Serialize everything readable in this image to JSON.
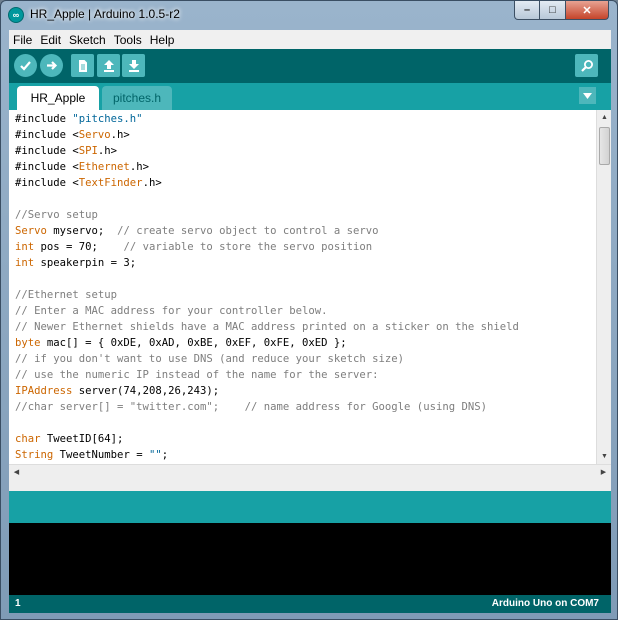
{
  "window": {
    "title": "HR_Apple | Arduino 1.0.5-r2",
    "icon": "arduino-logo-icon",
    "controls": {
      "minimize": "–",
      "maximize": "□",
      "close": "✕"
    }
  },
  "menu": {
    "items": [
      "File",
      "Edit",
      "Sketch",
      "Tools",
      "Help"
    ]
  },
  "toolbar": {
    "buttons": [
      {
        "name": "verify",
        "icon": "checkmark-icon"
      },
      {
        "name": "upload",
        "icon": "arrow-right-icon"
      },
      {
        "name": "new",
        "icon": "new-file-icon"
      },
      {
        "name": "open",
        "icon": "arrow-up-icon"
      },
      {
        "name": "save",
        "icon": "arrow-down-icon"
      },
      {
        "name": "serial-monitor",
        "icon": "magnifier-icon"
      }
    ]
  },
  "tabs": {
    "items": [
      "HR_Apple",
      "pitches.h"
    ],
    "active": "HR_Apple"
  },
  "editor": {
    "lines": [
      [
        {
          "t": "plain",
          "v": "#include "
        },
        {
          "t": "str",
          "v": "\"pitches.h\""
        }
      ],
      [
        {
          "t": "plain",
          "v": "#include <"
        },
        {
          "t": "kw",
          "v": "Servo"
        },
        {
          "t": "plain",
          "v": ".h>"
        }
      ],
      [
        {
          "t": "plain",
          "v": "#include <"
        },
        {
          "t": "kw",
          "v": "SPI"
        },
        {
          "t": "plain",
          "v": ".h>"
        }
      ],
      [
        {
          "t": "plain",
          "v": "#include <"
        },
        {
          "t": "kw",
          "v": "Ethernet"
        },
        {
          "t": "plain",
          "v": ".h>"
        }
      ],
      [
        {
          "t": "plain",
          "v": "#include <"
        },
        {
          "t": "kw",
          "v": "TextFinder"
        },
        {
          "t": "plain",
          "v": ".h>"
        }
      ],
      [],
      [
        {
          "t": "cmt",
          "v": "//Servo setup"
        }
      ],
      [
        {
          "t": "kw",
          "v": "Servo"
        },
        {
          "t": "plain",
          "v": " myservo;  "
        },
        {
          "t": "cmt",
          "v": "// create servo object to control a servo"
        }
      ],
      [
        {
          "t": "kw",
          "v": "int"
        },
        {
          "t": "plain",
          "v": " pos = 70;    "
        },
        {
          "t": "cmt",
          "v": "// variable to store the servo position"
        }
      ],
      [
        {
          "t": "kw",
          "v": "int"
        },
        {
          "t": "plain",
          "v": " speakerpin = 3;"
        }
      ],
      [],
      [
        {
          "t": "cmt",
          "v": "//Ethernet setup"
        }
      ],
      [
        {
          "t": "cmt",
          "v": "// Enter a MAC address for your controller below."
        }
      ],
      [
        {
          "t": "cmt",
          "v": "// Newer Ethernet shields have a MAC address printed on a sticker on the shield"
        }
      ],
      [
        {
          "t": "kw",
          "v": "byte"
        },
        {
          "t": "plain",
          "v": " mac[] = { 0xDE, 0xAD, 0xBE, 0xEF, 0xFE, 0xED };"
        }
      ],
      [
        {
          "t": "cmt",
          "v": "// if you don't want to use DNS (and reduce your sketch size)"
        }
      ],
      [
        {
          "t": "cmt",
          "v": "// use the numeric IP instead of the name for the server:"
        }
      ],
      [
        {
          "t": "kw",
          "v": "IPAddress"
        },
        {
          "t": "plain",
          "v": " server(74,208,26,243);"
        }
      ],
      [
        {
          "t": "cmt",
          "v": "//char server[] = \"twitter.com\";    // name address for Google (using DNS)"
        }
      ],
      [],
      [
        {
          "t": "kw",
          "v": "char"
        },
        {
          "t": "plain",
          "v": " TweetID[64];"
        }
      ],
      [
        {
          "t": "kw",
          "v": "String"
        },
        {
          "t": "plain",
          "v": " TweetNumber = "
        },
        {
          "t": "str",
          "v": "\"\""
        },
        {
          "t": "plain",
          "v": ";"
        }
      ]
    ]
  },
  "console": {
    "text": ""
  },
  "status": {
    "line": "1",
    "board": "Arduino Uno on COM7"
  },
  "colors": {
    "toolbar": "#006468",
    "tabs": "#17a1a5",
    "keyword": "#cc6600",
    "string": "#006699",
    "comment": "#7e7e7e"
  }
}
